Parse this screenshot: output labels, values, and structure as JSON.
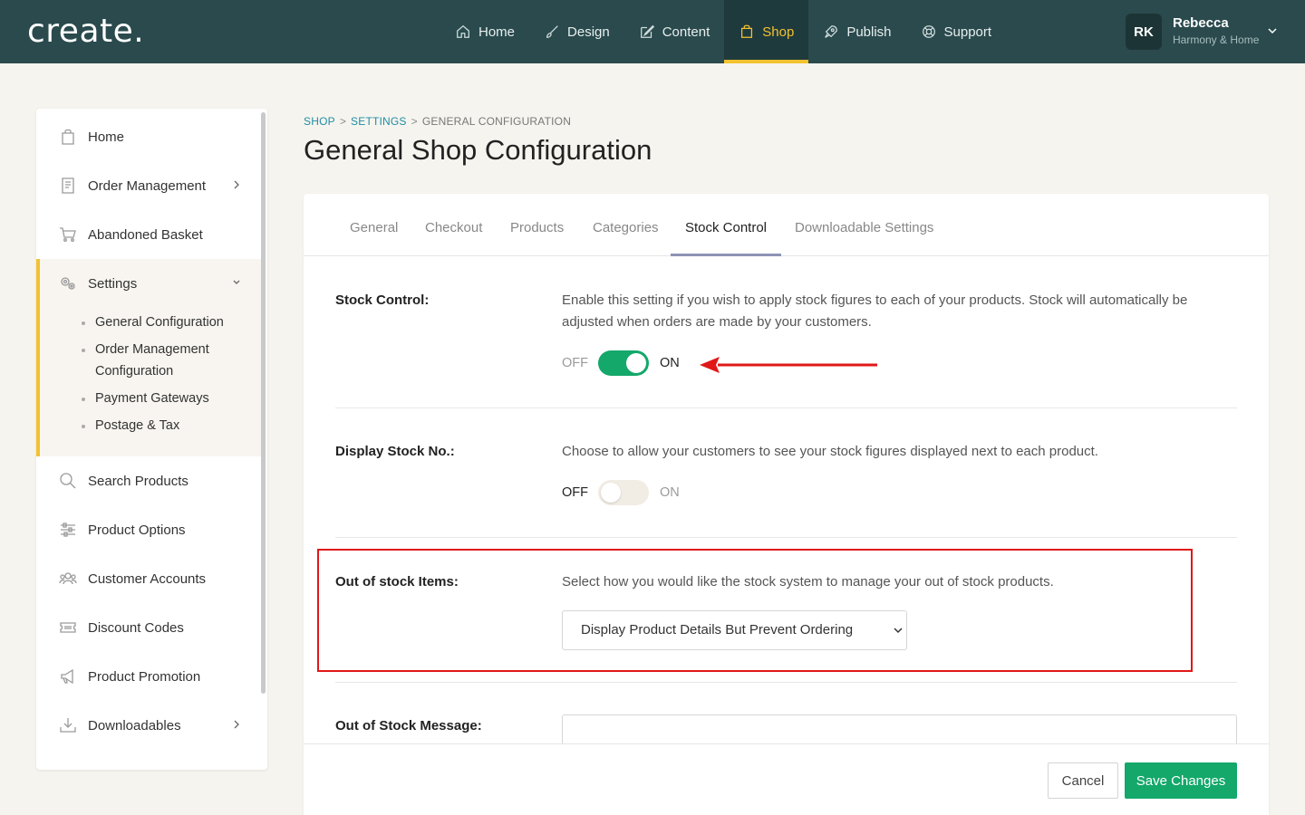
{
  "app": {
    "logo": "create."
  },
  "nav": {
    "items": [
      {
        "label": "Home",
        "icon": "home-icon"
      },
      {
        "label": "Design",
        "icon": "brush-icon"
      },
      {
        "label": "Content",
        "icon": "edit-icon"
      },
      {
        "label": "Shop",
        "icon": "shopping-bag-icon",
        "active": true
      },
      {
        "label": "Publish",
        "icon": "rocket-icon"
      },
      {
        "label": "Support",
        "icon": "lifebuoy-icon"
      }
    ]
  },
  "user": {
    "initials": "RK",
    "name": "Rebecca",
    "company": "Harmony & Home"
  },
  "sidebar": {
    "items": [
      {
        "label": "Home"
      },
      {
        "label": "Order Management"
      },
      {
        "label": "Abandoned Basket"
      },
      {
        "label": "Settings"
      },
      {
        "label": "Search Products"
      },
      {
        "label": "Product Options"
      },
      {
        "label": "Customer Accounts"
      },
      {
        "label": "Discount Codes"
      },
      {
        "label": "Product Promotion"
      },
      {
        "label": "Downloadables"
      }
    ],
    "settings_sub": [
      {
        "label": "General Configuration"
      },
      {
        "label": "Order Management Configuration"
      },
      {
        "label": "Payment Gateways"
      },
      {
        "label": "Postage & Tax"
      }
    ]
  },
  "breadcrumb": {
    "shop": "SHOP",
    "settings": "SETTINGS",
    "current": "GENERAL CONFIGURATION",
    "sep": ">"
  },
  "page": {
    "title": "General Shop Configuration"
  },
  "tabs": [
    {
      "label": "General"
    },
    {
      "label": "Checkout"
    },
    {
      "label": "Products"
    },
    {
      "label": "Categories"
    },
    {
      "label": "Stock Control",
      "active": true
    },
    {
      "label": "Downloadable Settings"
    }
  ],
  "stock_control": {
    "label": "Stock Control:",
    "description": "Enable this setting if you wish to apply stock figures to each of your products. Stock will automatically be adjusted when orders are made by your customers.",
    "off": "OFF",
    "on": "ON",
    "enabled": true
  },
  "display_stock": {
    "label": "Display Stock No.:",
    "description": "Choose to allow your customers to see your stock figures displayed next to each product.",
    "off": "OFF",
    "on": "ON",
    "enabled": false
  },
  "out_of_stock": {
    "label": "Out of stock Items:",
    "description": "Select how you would like the stock system to manage your out of stock products.",
    "selected": "Display Product Details But Prevent Ordering"
  },
  "out_of_stock_message": {
    "label": "Out of Stock Message:",
    "value": ""
  },
  "footer": {
    "cancel": "Cancel",
    "save": "Save Changes"
  },
  "colors": {
    "primary_nav": "#2a4a4d",
    "accent": "#f2c230",
    "toggle_on": "#14a86b",
    "save": "#14a86b",
    "annotation": "#e01818"
  }
}
